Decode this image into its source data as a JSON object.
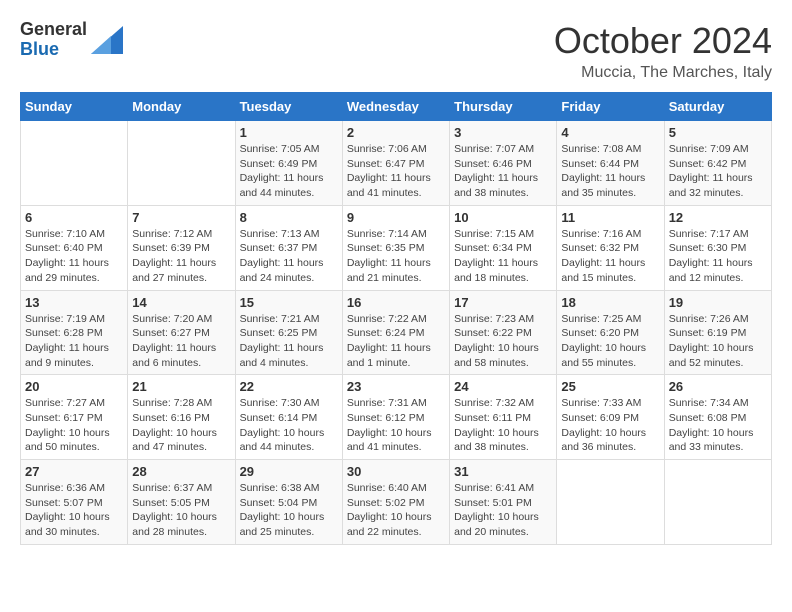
{
  "logo": {
    "general": "General",
    "blue": "Blue"
  },
  "title": "October 2024",
  "location": "Muccia, The Marches, Italy",
  "headers": [
    "Sunday",
    "Monday",
    "Tuesday",
    "Wednesday",
    "Thursday",
    "Friday",
    "Saturday"
  ],
  "weeks": [
    [
      {
        "day": "",
        "sunrise": "",
        "sunset": "",
        "daylight": ""
      },
      {
        "day": "",
        "sunrise": "",
        "sunset": "",
        "daylight": ""
      },
      {
        "day": "1",
        "sunrise": "Sunrise: 7:05 AM",
        "sunset": "Sunset: 6:49 PM",
        "daylight": "Daylight: 11 hours and 44 minutes."
      },
      {
        "day": "2",
        "sunrise": "Sunrise: 7:06 AM",
        "sunset": "Sunset: 6:47 PM",
        "daylight": "Daylight: 11 hours and 41 minutes."
      },
      {
        "day": "3",
        "sunrise": "Sunrise: 7:07 AM",
        "sunset": "Sunset: 6:46 PM",
        "daylight": "Daylight: 11 hours and 38 minutes."
      },
      {
        "day": "4",
        "sunrise": "Sunrise: 7:08 AM",
        "sunset": "Sunset: 6:44 PM",
        "daylight": "Daylight: 11 hours and 35 minutes."
      },
      {
        "day": "5",
        "sunrise": "Sunrise: 7:09 AM",
        "sunset": "Sunset: 6:42 PM",
        "daylight": "Daylight: 11 hours and 32 minutes."
      }
    ],
    [
      {
        "day": "6",
        "sunrise": "Sunrise: 7:10 AM",
        "sunset": "Sunset: 6:40 PM",
        "daylight": "Daylight: 11 hours and 29 minutes."
      },
      {
        "day": "7",
        "sunrise": "Sunrise: 7:12 AM",
        "sunset": "Sunset: 6:39 PM",
        "daylight": "Daylight: 11 hours and 27 minutes."
      },
      {
        "day": "8",
        "sunrise": "Sunrise: 7:13 AM",
        "sunset": "Sunset: 6:37 PM",
        "daylight": "Daylight: 11 hours and 24 minutes."
      },
      {
        "day": "9",
        "sunrise": "Sunrise: 7:14 AM",
        "sunset": "Sunset: 6:35 PM",
        "daylight": "Daylight: 11 hours and 21 minutes."
      },
      {
        "day": "10",
        "sunrise": "Sunrise: 7:15 AM",
        "sunset": "Sunset: 6:34 PM",
        "daylight": "Daylight: 11 hours and 18 minutes."
      },
      {
        "day": "11",
        "sunrise": "Sunrise: 7:16 AM",
        "sunset": "Sunset: 6:32 PM",
        "daylight": "Daylight: 11 hours and 15 minutes."
      },
      {
        "day": "12",
        "sunrise": "Sunrise: 7:17 AM",
        "sunset": "Sunset: 6:30 PM",
        "daylight": "Daylight: 11 hours and 12 minutes."
      }
    ],
    [
      {
        "day": "13",
        "sunrise": "Sunrise: 7:19 AM",
        "sunset": "Sunset: 6:28 PM",
        "daylight": "Daylight: 11 hours and 9 minutes."
      },
      {
        "day": "14",
        "sunrise": "Sunrise: 7:20 AM",
        "sunset": "Sunset: 6:27 PM",
        "daylight": "Daylight: 11 hours and 6 minutes."
      },
      {
        "day": "15",
        "sunrise": "Sunrise: 7:21 AM",
        "sunset": "Sunset: 6:25 PM",
        "daylight": "Daylight: 11 hours and 4 minutes."
      },
      {
        "day": "16",
        "sunrise": "Sunrise: 7:22 AM",
        "sunset": "Sunset: 6:24 PM",
        "daylight": "Daylight: 11 hours and 1 minute."
      },
      {
        "day": "17",
        "sunrise": "Sunrise: 7:23 AM",
        "sunset": "Sunset: 6:22 PM",
        "daylight": "Daylight: 10 hours and 58 minutes."
      },
      {
        "day": "18",
        "sunrise": "Sunrise: 7:25 AM",
        "sunset": "Sunset: 6:20 PM",
        "daylight": "Daylight: 10 hours and 55 minutes."
      },
      {
        "day": "19",
        "sunrise": "Sunrise: 7:26 AM",
        "sunset": "Sunset: 6:19 PM",
        "daylight": "Daylight: 10 hours and 52 minutes."
      }
    ],
    [
      {
        "day": "20",
        "sunrise": "Sunrise: 7:27 AM",
        "sunset": "Sunset: 6:17 PM",
        "daylight": "Daylight: 10 hours and 50 minutes."
      },
      {
        "day": "21",
        "sunrise": "Sunrise: 7:28 AM",
        "sunset": "Sunset: 6:16 PM",
        "daylight": "Daylight: 10 hours and 47 minutes."
      },
      {
        "day": "22",
        "sunrise": "Sunrise: 7:30 AM",
        "sunset": "Sunset: 6:14 PM",
        "daylight": "Daylight: 10 hours and 44 minutes."
      },
      {
        "day": "23",
        "sunrise": "Sunrise: 7:31 AM",
        "sunset": "Sunset: 6:12 PM",
        "daylight": "Daylight: 10 hours and 41 minutes."
      },
      {
        "day": "24",
        "sunrise": "Sunrise: 7:32 AM",
        "sunset": "Sunset: 6:11 PM",
        "daylight": "Daylight: 10 hours and 38 minutes."
      },
      {
        "day": "25",
        "sunrise": "Sunrise: 7:33 AM",
        "sunset": "Sunset: 6:09 PM",
        "daylight": "Daylight: 10 hours and 36 minutes."
      },
      {
        "day": "26",
        "sunrise": "Sunrise: 7:34 AM",
        "sunset": "Sunset: 6:08 PM",
        "daylight": "Daylight: 10 hours and 33 minutes."
      }
    ],
    [
      {
        "day": "27",
        "sunrise": "Sunrise: 6:36 AM",
        "sunset": "Sunset: 5:07 PM",
        "daylight": "Daylight: 10 hours and 30 minutes."
      },
      {
        "day": "28",
        "sunrise": "Sunrise: 6:37 AM",
        "sunset": "Sunset: 5:05 PM",
        "daylight": "Daylight: 10 hours and 28 minutes."
      },
      {
        "day": "29",
        "sunrise": "Sunrise: 6:38 AM",
        "sunset": "Sunset: 5:04 PM",
        "daylight": "Daylight: 10 hours and 25 minutes."
      },
      {
        "day": "30",
        "sunrise": "Sunrise: 6:40 AM",
        "sunset": "Sunset: 5:02 PM",
        "daylight": "Daylight: 10 hours and 22 minutes."
      },
      {
        "day": "31",
        "sunrise": "Sunrise: 6:41 AM",
        "sunset": "Sunset: 5:01 PM",
        "daylight": "Daylight: 10 hours and 20 minutes."
      },
      {
        "day": "",
        "sunrise": "",
        "sunset": "",
        "daylight": ""
      },
      {
        "day": "",
        "sunrise": "",
        "sunset": "",
        "daylight": ""
      }
    ]
  ]
}
